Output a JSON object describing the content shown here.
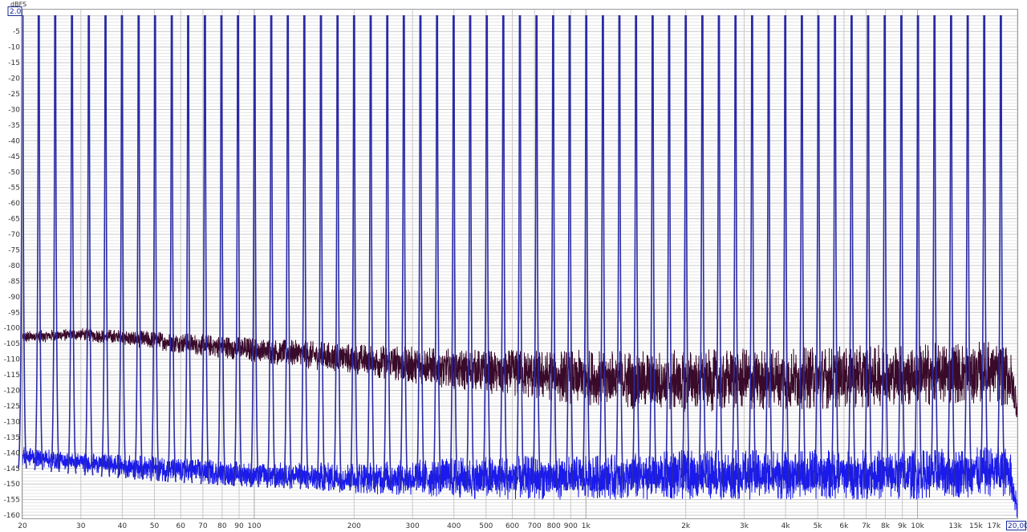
{
  "chart_data": {
    "type": "line",
    "title": "",
    "xlabel": "",
    "ylabel": "dBFS",
    "x_scale": "log",
    "xlim": [
      20,
      20000
    ],
    "ylim": [
      -161,
      2
    ],
    "grid": true,
    "legend": "none",
    "y_ticks": [
      -5,
      -10,
      -15,
      -20,
      -25,
      -30,
      -35,
      -40,
      -45,
      -50,
      -55,
      -60,
      -65,
      -70,
      -75,
      -80,
      -85,
      -90,
      -95,
      -100,
      -105,
      -110,
      -115,
      -120,
      -125,
      -130,
      -135,
      -140,
      -145,
      -150,
      -155,
      -160
    ],
    "y_cursor_label": "2.0",
    "x_ticks": [
      {
        "v": 20,
        "t": "20"
      },
      {
        "v": 30,
        "t": "30"
      },
      {
        "v": 40,
        "t": "40"
      },
      {
        "v": 50,
        "t": "50"
      },
      {
        "v": 60,
        "t": "60"
      },
      {
        "v": 70,
        "t": "70"
      },
      {
        "v": 80,
        "t": "80"
      },
      {
        "v": 90,
        "t": "90"
      },
      {
        "v": 100,
        "t": "100"
      },
      {
        "v": 200,
        "t": "200"
      },
      {
        "v": 300,
        "t": "300"
      },
      {
        "v": 400,
        "t": "400"
      },
      {
        "v": 500,
        "t": "500"
      },
      {
        "v": 600,
        "t": "600"
      },
      {
        "v": 700,
        "t": "700"
      },
      {
        "v": 800,
        "t": "800"
      },
      {
        "v": 900,
        "t": "900"
      },
      {
        "v": 1000,
        "t": "1k"
      },
      {
        "v": 2000,
        "t": "2k"
      },
      {
        "v": 3000,
        "t": "3k"
      },
      {
        "v": 4000,
        "t": "4k"
      },
      {
        "v": 5000,
        "t": "5k"
      },
      {
        "v": 6000,
        "t": "6k"
      },
      {
        "v": 7000,
        "t": "7k"
      },
      {
        "v": 8000,
        "t": "8k"
      },
      {
        "v": 9000,
        "t": "9k"
      },
      {
        "v": 10000,
        "t": "10k"
      },
      {
        "v": 13000,
        "t": "13k"
      },
      {
        "v": 15000,
        "t": "15k"
      },
      {
        "v": 17000,
        "t": "17k"
      }
    ],
    "x_cursor_label": "20,00k",
    "colors": {
      "blue_series": "#1a1aee",
      "dark_series": "#3a0a2a",
      "tone_line": "#2a2aa6",
      "grid_major": "#c8c8c8",
      "grid_minor": "#e6e6e6"
    },
    "series": [
      {
        "color": "#3a0a2a",
        "noise_floor": {
          "x": [
            20,
            30,
            50,
            100,
            200,
            500,
            1000,
            2000,
            5000,
            10000,
            17000,
            19000,
            20000
          ],
          "y_mid": [
            -103,
            -102,
            -104,
            -107,
            -110,
            -114,
            -116,
            -117,
            -116,
            -115,
            -114,
            -116,
            -126
          ],
          "spread": [
            2,
            2,
            3,
            4,
            5,
            7,
            9,
            10,
            10,
            10,
            10,
            10,
            6
          ]
        }
      },
      {
        "color": "#1a1aee",
        "noise_floor": {
          "x": [
            20,
            30,
            50,
            100,
            200,
            500,
            1000,
            2000,
            5000,
            10000,
            17000,
            19000,
            20000
          ],
          "y_mid": [
            -141,
            -143,
            -145,
            -147,
            -148,
            -148,
            -148,
            -147,
            -147,
            -147,
            -146,
            -146,
            -158
          ],
          "spread": [
            3,
            3,
            4,
            4,
            5,
            7,
            7,
            8,
            8,
            8,
            8,
            8,
            4
          ]
        },
        "tones_hz": [
          20,
          22.4,
          25.1,
          28.2,
          31.7,
          35.6,
          39.9,
          44.8,
          50.2,
          56.4,
          63.2,
          71,
          79.6,
          89.3,
          100.2,
          112.5,
          126.2,
          141.6,
          158.9,
          178.3,
          200,
          224.4,
          251.8,
          282.5,
          317,
          355.7,
          399.1,
          447.8,
          502.4,
          563.7,
          632.5,
          709.7,
          796.3,
          893.5,
          1002.5,
          1124.8,
          1262.1,
          1416.1,
          1588.9,
          1782.8,
          2000.3,
          2244.5,
          2518.4,
          2825.7,
          3170.5,
          3557.4,
          3991.5,
          4478.6,
          5025.1,
          5638.2,
          6326.3,
          7098.2,
          7964.4,
          8936.3,
          10026.7,
          11250.2,
          12623,
          14163.3,
          15891.6,
          17830.8
        ],
        "tone_level_db": 0
      }
    ]
  }
}
